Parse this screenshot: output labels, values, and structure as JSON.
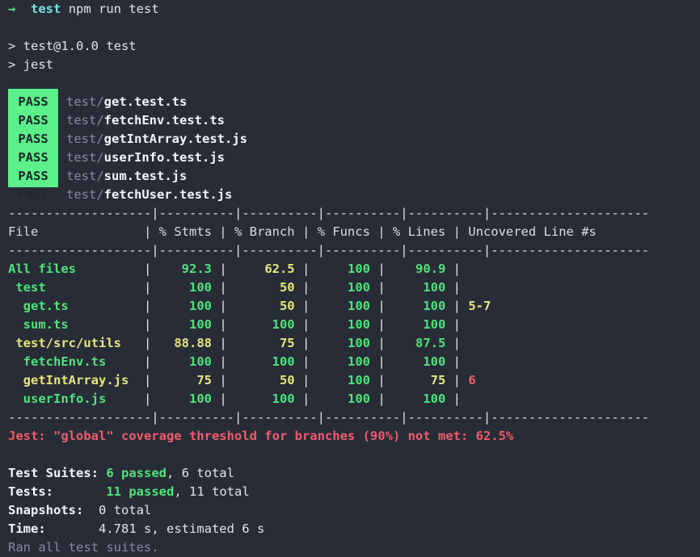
{
  "terminal": {
    "background": "#282c36",
    "foreground": "#d8dde6",
    "prompt": {
      "arrow": "→",
      "context": "test",
      "command": "npm run test"
    },
    "npm_lines": [
      "> test@1.0.0 test",
      "> jest"
    ],
    "pass_badge_label": "PASS",
    "suites": [
      {
        "dir": "test/",
        "file": "get.test.ts"
      },
      {
        "dir": "test/",
        "file": "fetchEnv.test.ts"
      },
      {
        "dir": "test/",
        "file": "getIntArray.test.js"
      },
      {
        "dir": "test/",
        "file": "userInfo.test.js"
      },
      {
        "dir": "test/",
        "file": "sum.test.js"
      },
      {
        "dir": "test/",
        "file": "fetchUser.test.js"
      }
    ],
    "coverage_table": {
      "rule_file": "-------------------",
      "rule_stmts": "----------",
      "rule_branch": "----------",
      "rule_funcs": "----------",
      "rule_lines": "----------",
      "rule_uncovered": "---------------------",
      "headers": {
        "file": "File",
        "stmts": "% Stmts",
        "branch": "% Branch",
        "funcs": "% Funcs",
        "lines": "% Lines",
        "uncovered": "Uncovered Line #s"
      },
      "rows": [
        {
          "name": "All files",
          "indent": 0,
          "name_color": "green",
          "stmts": "92.3",
          "stmts_color": "green",
          "branch": "62.5",
          "branch_color": "yellow",
          "funcs": "100",
          "funcs_color": "green",
          "lines": "90.9",
          "lines_color": "green",
          "uncovered": "",
          "uncovered_color": "yellow"
        },
        {
          "name": "test",
          "indent": 1,
          "name_color": "green",
          "stmts": "100",
          "stmts_color": "green",
          "branch": "50",
          "branch_color": "yellow",
          "funcs": "100",
          "funcs_color": "green",
          "lines": "100",
          "lines_color": "green",
          "uncovered": "",
          "uncovered_color": "yellow"
        },
        {
          "name": "get.ts",
          "indent": 2,
          "name_color": "green",
          "stmts": "100",
          "stmts_color": "green",
          "branch": "50",
          "branch_color": "yellow",
          "funcs": "100",
          "funcs_color": "green",
          "lines": "100",
          "lines_color": "green",
          "uncovered": "5-7",
          "uncovered_color": "yellow"
        },
        {
          "name": "sum.ts",
          "indent": 2,
          "name_color": "green",
          "stmts": "100",
          "stmts_color": "green",
          "branch": "100",
          "branch_color": "green",
          "funcs": "100",
          "funcs_color": "green",
          "lines": "100",
          "lines_color": "green",
          "uncovered": "",
          "uncovered_color": "yellow"
        },
        {
          "name": "test/src/utils",
          "indent": 1,
          "name_color": "yellow",
          "stmts": "88.88",
          "stmts_color": "yellow",
          "branch": "75",
          "branch_color": "yellow",
          "funcs": "100",
          "funcs_color": "green",
          "lines": "87.5",
          "lines_color": "green",
          "uncovered": "",
          "uncovered_color": "yellow"
        },
        {
          "name": "fetchEnv.ts",
          "indent": 2,
          "name_color": "green",
          "stmts": "100",
          "stmts_color": "green",
          "branch": "100",
          "branch_color": "green",
          "funcs": "100",
          "funcs_color": "green",
          "lines": "100",
          "lines_color": "green",
          "uncovered": "",
          "uncovered_color": "yellow"
        },
        {
          "name": "getIntArray.js",
          "indent": 2,
          "name_color": "yellow",
          "stmts": "75",
          "stmts_color": "yellow",
          "branch": "50",
          "branch_color": "yellow",
          "funcs": "100",
          "funcs_color": "green",
          "lines": "75",
          "lines_color": "yellow",
          "uncovered": "6",
          "uncovered_color": "red"
        },
        {
          "name": "userInfo.js",
          "indent": 2,
          "name_color": "green",
          "stmts": "100",
          "stmts_color": "green",
          "branch": "100",
          "branch_color": "green",
          "funcs": "100",
          "funcs_color": "green",
          "lines": "100",
          "lines_color": "green",
          "uncovered": "",
          "uncovered_color": "yellow"
        }
      ]
    },
    "threshold_error": "Jest: \"global\" coverage threshold for branches (90%) not met: 62.5%",
    "summary": {
      "suites_label": "Test Suites:",
      "suites_passed": "6 passed",
      "suites_total": ", 6 total",
      "tests_label": "Tests:",
      "tests_passed": "11 passed",
      "tests_total": ", 11 total",
      "snapshots_label": "Snapshots:",
      "snapshots_value": "0 total",
      "time_label": "Time:",
      "time_value": "4.781 s, estimated 6 s",
      "ran_all": "Ran all test suites."
    },
    "colors": {
      "green": "#4fe37d",
      "yellow": "#e6e680",
      "red": "#f05c6c",
      "cyan": "#76e3e0",
      "grey": "#848c9b",
      "pass_badge_bg": "#5bf08a"
    }
  }
}
